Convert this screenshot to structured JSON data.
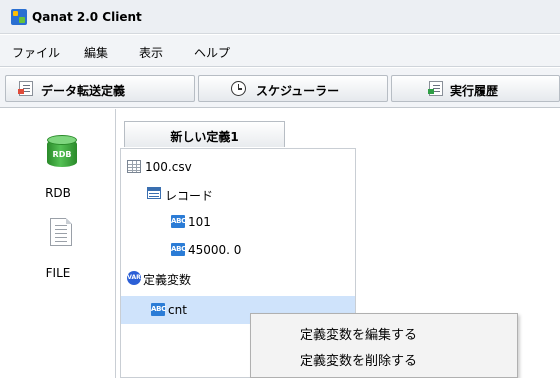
{
  "app": {
    "title": "Qanat 2.0 Client"
  },
  "menu": {
    "items": [
      "ファイル",
      "編集",
      "表示",
      "ヘルプ"
    ]
  },
  "toolbar": {
    "tabs": [
      {
        "label": "データ転送定義",
        "icon": "data-transfer-doc-icon"
      },
      {
        "label": "スケジューラー",
        "icon": "clock-icon"
      },
      {
        "label": "実行履歴",
        "icon": "history-doc-icon"
      }
    ]
  },
  "left_panel": {
    "items": [
      {
        "label": "RDB",
        "icon_text": "RDB",
        "icon": "rdb-icon"
      },
      {
        "label": "FILE",
        "icon": "file-icon"
      }
    ]
  },
  "definition": {
    "tab_label": "新しい定義1",
    "tree": [
      {
        "label": "100.csv",
        "icon": "csv-file-icon"
      },
      {
        "label": "レコード",
        "icon": "record-icon"
      },
      {
        "label": "101",
        "icon": "abc-icon",
        "icon_text": "ABC"
      },
      {
        "label": "45000. 0",
        "icon": "abc-icon",
        "icon_text": "ABC"
      },
      {
        "label": "定義変数",
        "icon": "var-icon",
        "icon_text": "VAR"
      },
      {
        "label": "cnt",
        "icon": "abc-icon",
        "icon_text": "ABC",
        "selected": true
      }
    ]
  },
  "context_menu": {
    "items": [
      "定義変数を編集する",
      "定義変数を削除する"
    ]
  },
  "colors": {
    "selection": "#cfe3fb",
    "abc_icon": "#2b7cd6",
    "rdb_green": "#55c155"
  }
}
